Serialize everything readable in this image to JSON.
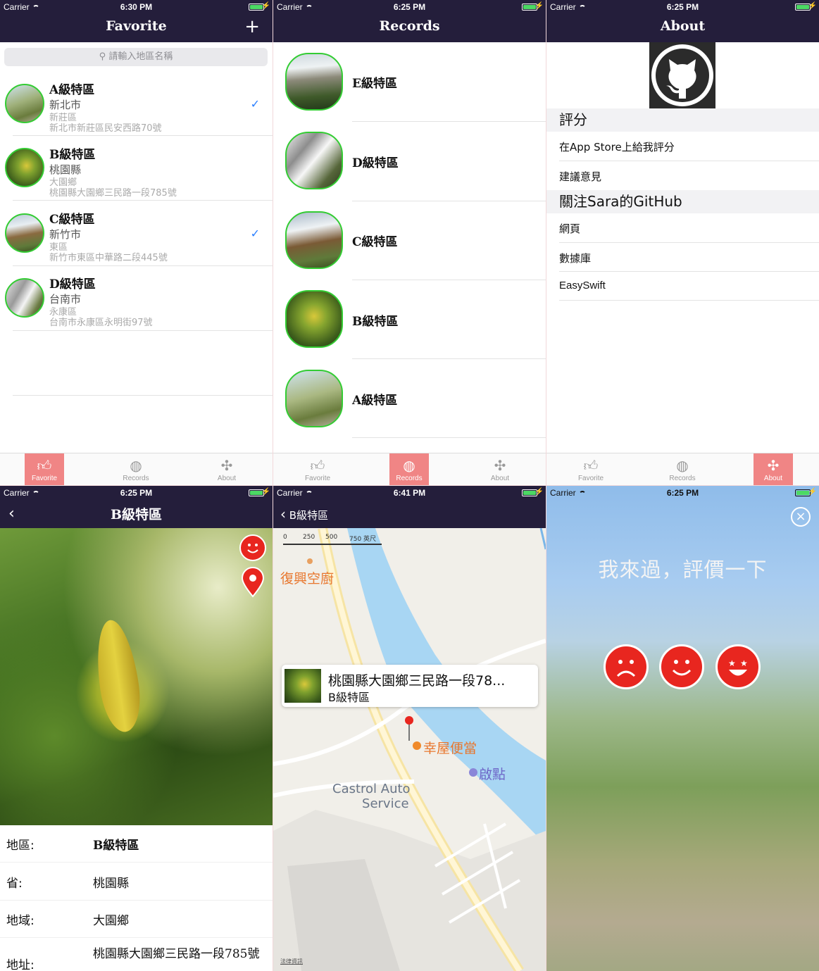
{
  "status": {
    "carrier": "Carrier",
    "times": [
      "6:30 PM",
      "6:25 PM",
      "6:25 PM",
      "6:25 PM",
      "6:41 PM",
      "6:25 PM"
    ]
  },
  "favorite": {
    "title": "Favorite",
    "search_placeholder": "請輸入地區名稱",
    "items": [
      {
        "name": "A級特區",
        "city": "新北市",
        "district": "新莊區",
        "address": "新北市新莊區民安西路70號",
        "checked": true
      },
      {
        "name": "B級特區",
        "city": "桃園縣",
        "district": "大園鄉",
        "address": "桃園縣大園鄉三民路一段785號",
        "checked": false
      },
      {
        "name": "C級特區",
        "city": "新竹市",
        "district": "東區",
        "address": "新竹市東區中華路二段445號",
        "checked": true
      },
      {
        "name": "D級特區",
        "city": "台南市",
        "district": "永康區",
        "address": "台南市永康區永明街97號",
        "checked": false
      }
    ],
    "check_icon": "✓"
  },
  "records": {
    "title": "Records",
    "items": [
      "E級特區",
      "D級特區",
      "C級特區",
      "B級特區",
      "A級特區"
    ]
  },
  "about": {
    "title": "About",
    "sections": [
      {
        "header": "評分",
        "items": [
          "在App Store上給我評分",
          "建議意見"
        ]
      },
      {
        "header": "關注Sara的GitHub",
        "items": [
          "網頁",
          "數據庫",
          "EasySwift"
        ]
      }
    ]
  },
  "tabs": [
    {
      "label": "Favorite",
      "icon": "thumbs-up-icon"
    },
    {
      "label": "Records",
      "icon": "ball-icon"
    },
    {
      "label": "About",
      "icon": "network-icon"
    }
  ],
  "detail": {
    "title": "B級特區",
    "rows": [
      {
        "label": "地區:",
        "value": "B級特區"
      },
      {
        "label": "省:",
        "value": "桃園縣"
      },
      {
        "label": "地域:",
        "value": "大園鄉"
      },
      {
        "label": "地址:",
        "value": "桃園縣大園鄉三民路一段785號"
      }
    ]
  },
  "map": {
    "back_label": "B級特區",
    "scale_labels": [
      "0",
      "250",
      "500",
      "750 英尺"
    ],
    "callout_title": "桃園縣大園鄉三民路一段78...",
    "callout_subtitle": "B級特區",
    "poi": [
      "復興空廚",
      "幸屋便當",
      "啟點",
      "Castrol Auto",
      "Service"
    ],
    "legal": "法律資訊"
  },
  "rate": {
    "prompt": "我來過，評價一下"
  },
  "colors": {
    "navbar": "#241e3b",
    "tab_active": "#f08585",
    "accent_check": "#2a7fff",
    "avatar_border": "#33cc33",
    "emoji_red": "#e8261f"
  }
}
